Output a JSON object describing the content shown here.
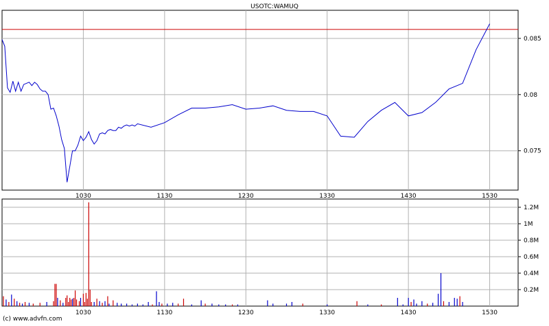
{
  "chart_data": [
    {
      "type": "line",
      "title": "USOTC:WAMUQ",
      "x_ticks": [
        "1030",
        "1130",
        "1230",
        "1330",
        "1430",
        "1530"
      ],
      "y_ticks": [
        "0.075",
        "0.08",
        "0.085"
      ],
      "ylim": [
        0.0715,
        0.0875
      ],
      "xlim_minutes_from_start": [
        0,
        381
      ],
      "grid": true,
      "reference_line": {
        "value": 0.0858,
        "color": "#cc0000"
      },
      "line_color": "#0000cc",
      "x_minutes": [
        0,
        2,
        4,
        6,
        8,
        10,
        12,
        14,
        16,
        18,
        20,
        22,
        24,
        26,
        28,
        30,
        32,
        34,
        36,
        38,
        40,
        42,
        44,
        46,
        48,
        50,
        52,
        54,
        56,
        58,
        60,
        62,
        64,
        66,
        68,
        70,
        72,
        74,
        76,
        78,
        80,
        82,
        84,
        86,
        88,
        90,
        92,
        94,
        96,
        98,
        100,
        110,
        120,
        130,
        140,
        150,
        160,
        170,
        180,
        190,
        200,
        210,
        220,
        230,
        240,
        250,
        260,
        270,
        280,
        290,
        300,
        310,
        320,
        330,
        340,
        350,
        360
      ],
      "values": [
        0.0849,
        0.0843,
        0.0806,
        0.0802,
        0.0812,
        0.0803,
        0.0811,
        0.0803,
        0.0809,
        0.081,
        0.0811,
        0.0808,
        0.0811,
        0.0809,
        0.0805,
        0.0803,
        0.0803,
        0.08,
        0.0787,
        0.0788,
        0.0781,
        0.0772,
        0.076,
        0.0752,
        0.0722,
        0.0736,
        0.075,
        0.075,
        0.0755,
        0.0763,
        0.0759,
        0.0762,
        0.0767,
        0.076,
        0.0756,
        0.0759,
        0.0765,
        0.0766,
        0.0765,
        0.0768,
        0.0769,
        0.0768,
        0.0768,
        0.0771,
        0.077,
        0.0772,
        0.0773,
        0.0772,
        0.0773,
        0.0772,
        0.0774,
        0.0771,
        0.0775,
        0.0782,
        0.0788,
        0.0788,
        0.0789,
        0.0791,
        0.0787,
        0.0788,
        0.079,
        0.0786,
        0.0785,
        0.0785,
        0.0781,
        0.0763,
        0.0762,
        0.0776,
        0.0786,
        0.0793,
        0.0781,
        0.0784,
        0.0793,
        0.0805,
        0.081,
        0.084,
        0.0863
      ]
    },
    {
      "type": "bar",
      "title": "",
      "x_ticks": [
        "1030",
        "1130",
        "1230",
        "1330",
        "1430",
        "1530"
      ],
      "y_ticks": [
        "0.2M",
        "0.4M",
        "0.6M",
        "0.8M",
        "1M",
        "1.2M"
      ],
      "ylim": [
        0,
        1.3
      ],
      "colors": {
        "up": "#0000cc",
        "down": "#cc0000"
      },
      "bars": [
        {
          "minute": 1,
          "value": 0.12,
          "dir": "down"
        },
        {
          "minute": 3,
          "value": 0.08,
          "dir": "up"
        },
        {
          "minute": 5,
          "value": 0.05,
          "dir": "down"
        },
        {
          "minute": 7,
          "value": 0.14,
          "dir": "up"
        },
        {
          "minute": 9,
          "value": 0.09,
          "dir": "down"
        },
        {
          "minute": 11,
          "value": 0.06,
          "dir": "up"
        },
        {
          "minute": 13,
          "value": 0.04,
          "dir": "down"
        },
        {
          "minute": 15,
          "value": 0.03,
          "dir": "up"
        },
        {
          "minute": 17,
          "value": 0.05,
          "dir": "down"
        },
        {
          "minute": 20,
          "value": 0.04,
          "dir": "up"
        },
        {
          "minute": 23,
          "value": 0.03,
          "dir": "down"
        },
        {
          "minute": 28,
          "value": 0.04,
          "dir": "down"
        },
        {
          "minute": 33,
          "value": 0.05,
          "dir": "up"
        },
        {
          "minute": 38,
          "value": 0.06,
          "dir": "down"
        },
        {
          "minute": 39,
          "value": 0.27,
          "dir": "down"
        },
        {
          "minute": 40,
          "value": 0.27,
          "dir": "down"
        },
        {
          "minute": 41,
          "value": 0.1,
          "dir": "up"
        },
        {
          "minute": 43,
          "value": 0.07,
          "dir": "down"
        },
        {
          "minute": 45,
          "value": 0.04,
          "dir": "up"
        },
        {
          "minute": 47,
          "value": 0.1,
          "dir": "down"
        },
        {
          "minute": 48,
          "value": 0.13,
          "dir": "down"
        },
        {
          "minute": 49,
          "value": 0.05,
          "dir": "down"
        },
        {
          "minute": 50,
          "value": 0.1,
          "dir": "down"
        },
        {
          "minute": 51,
          "value": 0.08,
          "dir": "down"
        },
        {
          "minute": 52,
          "value": 0.09,
          "dir": "up"
        },
        {
          "minute": 53,
          "value": 0.1,
          "dir": "down"
        },
        {
          "minute": 54,
          "value": 0.19,
          "dir": "down"
        },
        {
          "minute": 55,
          "value": 0.08,
          "dir": "down"
        },
        {
          "minute": 57,
          "value": 0.06,
          "dir": "down"
        },
        {
          "minute": 58,
          "value": 0.1,
          "dir": "up"
        },
        {
          "minute": 60,
          "value": 0.15,
          "dir": "down"
        },
        {
          "minute": 61,
          "value": 0.05,
          "dir": "down"
        },
        {
          "minute": 62,
          "value": 0.16,
          "dir": "down"
        },
        {
          "minute": 63,
          "value": 0.09,
          "dir": "down"
        },
        {
          "minute": 64,
          "value": 1.26,
          "dir": "down"
        },
        {
          "minute": 65,
          "value": 0.2,
          "dir": "down"
        },
        {
          "minute": 66,
          "value": 0.05,
          "dir": "down"
        },
        {
          "minute": 68,
          "value": 0.05,
          "dir": "up"
        },
        {
          "minute": 70,
          "value": 0.09,
          "dir": "down"
        },
        {
          "minute": 72,
          "value": 0.06,
          "dir": "up"
        },
        {
          "minute": 74,
          "value": 0.04,
          "dir": "down"
        },
        {
          "minute": 76,
          "value": 0.06,
          "dir": "up"
        },
        {
          "minute": 78,
          "value": 0.12,
          "dir": "down"
        },
        {
          "minute": 79,
          "value": 0.03,
          "dir": "up"
        },
        {
          "minute": 82,
          "value": 0.07,
          "dir": "down"
        },
        {
          "minute": 85,
          "value": 0.04,
          "dir": "up"
        },
        {
          "minute": 88,
          "value": 0.03,
          "dir": "up"
        },
        {
          "minute": 92,
          "value": 0.03,
          "dir": "up"
        },
        {
          "minute": 96,
          "value": 0.02,
          "dir": "up"
        },
        {
          "minute": 100,
          "value": 0.03,
          "dir": "up"
        },
        {
          "minute": 104,
          "value": 0.02,
          "dir": "up"
        },
        {
          "minute": 108,
          "value": 0.05,
          "dir": "up"
        },
        {
          "minute": 111,
          "value": 0.02,
          "dir": "down"
        },
        {
          "minute": 114,
          "value": 0.18,
          "dir": "up"
        },
        {
          "minute": 116,
          "value": 0.05,
          "dir": "up"
        },
        {
          "minute": 118,
          "value": 0.03,
          "dir": "down"
        },
        {
          "minute": 122,
          "value": 0.03,
          "dir": "up"
        },
        {
          "minute": 126,
          "value": 0.04,
          "dir": "up"
        },
        {
          "minute": 130,
          "value": 0.03,
          "dir": "down"
        },
        {
          "minute": 134,
          "value": 0.09,
          "dir": "down"
        },
        {
          "minute": 140,
          "value": 0.02,
          "dir": "up"
        },
        {
          "minute": 147,
          "value": 0.07,
          "dir": "up"
        },
        {
          "minute": 150,
          "value": 0.03,
          "dir": "down"
        },
        {
          "minute": 155,
          "value": 0.03,
          "dir": "up"
        },
        {
          "minute": 160,
          "value": 0.02,
          "dir": "up"
        },
        {
          "minute": 165,
          "value": 0.02,
          "dir": "up"
        },
        {
          "minute": 170,
          "value": 0.02,
          "dir": "down"
        },
        {
          "minute": 174,
          "value": 0.02,
          "dir": "up"
        },
        {
          "minute": 196,
          "value": 0.07,
          "dir": "up"
        },
        {
          "minute": 200,
          "value": 0.03,
          "dir": "up"
        },
        {
          "minute": 210,
          "value": 0.03,
          "dir": "up"
        },
        {
          "minute": 214,
          "value": 0.05,
          "dir": "up"
        },
        {
          "minute": 222,
          "value": 0.03,
          "dir": "down"
        },
        {
          "minute": 240,
          "value": 0.02,
          "dir": "up"
        },
        {
          "minute": 262,
          "value": 0.06,
          "dir": "down"
        },
        {
          "minute": 270,
          "value": 0.02,
          "dir": "up"
        },
        {
          "minute": 280,
          "value": 0.02,
          "dir": "down"
        },
        {
          "minute": 292,
          "value": 0.1,
          "dir": "up"
        },
        {
          "minute": 296,
          "value": 0.02,
          "dir": "up"
        },
        {
          "minute": 300,
          "value": 0.1,
          "dir": "up"
        },
        {
          "minute": 302,
          "value": 0.05,
          "dir": "down"
        },
        {
          "minute": 304,
          "value": 0.08,
          "dir": "up"
        },
        {
          "minute": 306,
          "value": 0.03,
          "dir": "up"
        },
        {
          "minute": 310,
          "value": 0.06,
          "dir": "up"
        },
        {
          "minute": 314,
          "value": 0.03,
          "dir": "down"
        },
        {
          "minute": 318,
          "value": 0.04,
          "dir": "up"
        },
        {
          "minute": 322,
          "value": 0.15,
          "dir": "up"
        },
        {
          "minute": 324,
          "value": 0.4,
          "dir": "up"
        },
        {
          "minute": 326,
          "value": 0.06,
          "dir": "down"
        },
        {
          "minute": 330,
          "value": 0.05,
          "dir": "up"
        },
        {
          "minute": 334,
          "value": 0.1,
          "dir": "up"
        },
        {
          "minute": 336,
          "value": 0.09,
          "dir": "up"
        },
        {
          "minute": 338,
          "value": 0.12,
          "dir": "down"
        },
        {
          "minute": 340,
          "value": 0.05,
          "dir": "up"
        }
      ]
    }
  ],
  "credit": "(c) www.advfn.com"
}
